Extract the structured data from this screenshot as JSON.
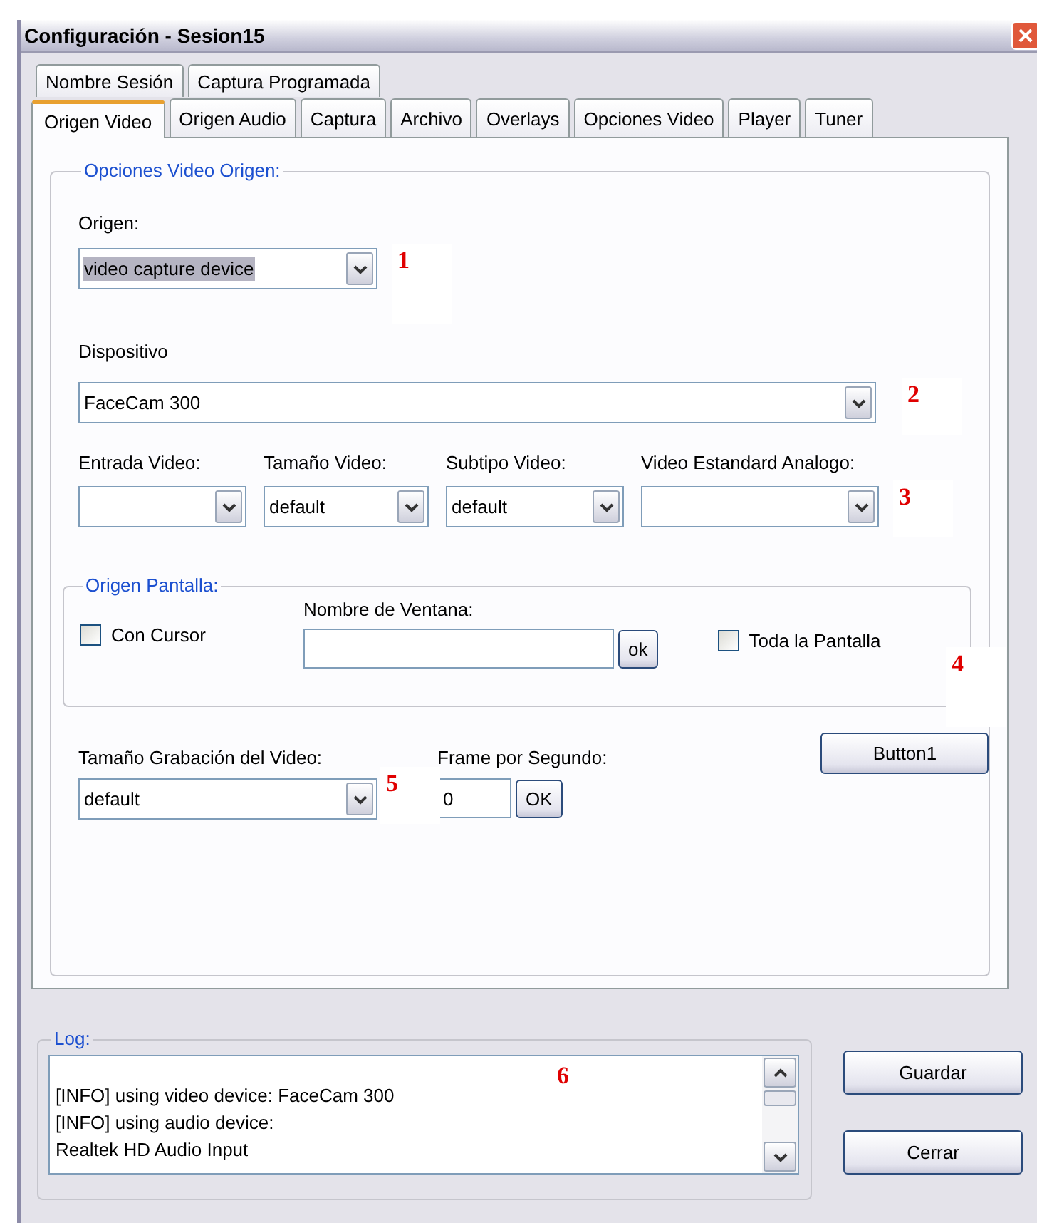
{
  "window": {
    "title": "Configuración - Sesion15"
  },
  "tab_rows": [
    [
      {
        "label": "Nombre Sesión",
        "selected": false
      },
      {
        "label": "Captura Programada",
        "selected": false
      }
    ],
    [
      {
        "label": "Origen Video",
        "selected": true
      },
      {
        "label": "Origen Audio",
        "selected": false
      },
      {
        "label": "Captura",
        "selected": false
      },
      {
        "label": "Archivo",
        "selected": false
      },
      {
        "label": "Overlays",
        "selected": false
      },
      {
        "label": "Opciones Video",
        "selected": false
      },
      {
        "label": "Player",
        "selected": false
      },
      {
        "label": "Tuner",
        "selected": false
      }
    ]
  ],
  "video_source": {
    "legend": "Opciones Video Origen:",
    "origin": {
      "label": "Origen:",
      "value": "video capture device",
      "highlighted": true,
      "annotation": "1"
    },
    "device": {
      "label": "Dispositivo",
      "value": "FaceCam 300",
      "annotation": "2"
    },
    "selects": [
      {
        "label": "Entrada Video:"
      },
      {
        "label": "Tamaño Video:",
        "value": "default"
      },
      {
        "label": "Subtipo Video:",
        "value": "default"
      },
      {
        "label": "Video Estandard Analogo:"
      }
    ],
    "selects_annotation": "3",
    "screen_source": {
      "legend": "Origen Pantalla:",
      "cursor_checkbox": {
        "label": "Con Cursor",
        "checked": false
      },
      "window_name": {
        "label": "Nombre de Ventana:",
        "button": "ok"
      },
      "fullscreen_checkbox": {
        "label": "Toda la Pantalla",
        "checked": false
      },
      "annotation": "4"
    },
    "recording_size": {
      "label": "Tamaño Grabación del Video:",
      "value": "default",
      "annotation": "5"
    },
    "fps": {
      "label": "Frame por Segundo:",
      "value": "0",
      "button": "OK"
    },
    "button": "Button1"
  },
  "log": {
    "legend": "Log:",
    "lines": [
      "[INFO] using video device: FaceCam 300",
      "[INFO] using audio device:",
      "Realtek HD Audio Input"
    ],
    "annotation": "6"
  },
  "buttons": [
    "Guardar",
    "Cerrar"
  ]
}
